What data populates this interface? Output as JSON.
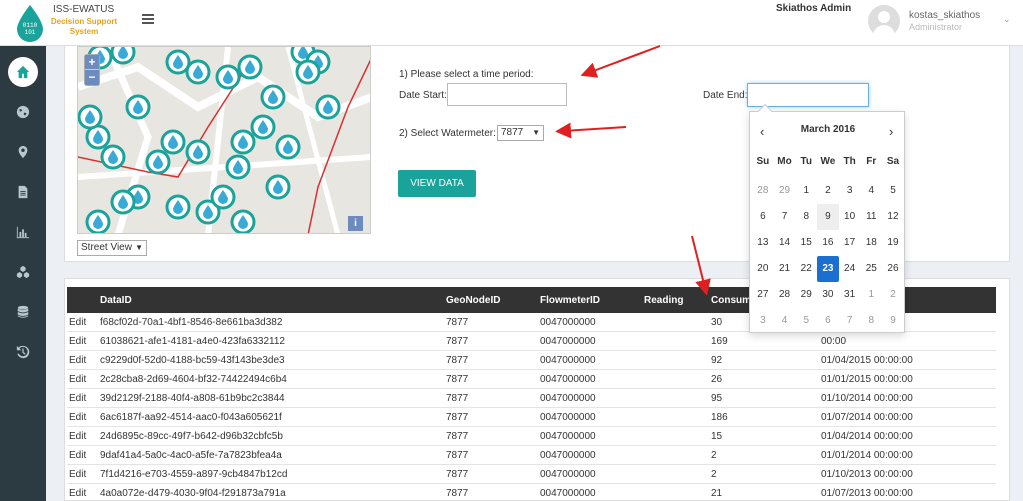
{
  "header": {
    "app_title": "ISS-EWATUS",
    "app_subtitle": "Decision Support System",
    "admin_label": "Skiathos Admin",
    "user_name": "kostas_skiathos",
    "user_role": "Administrator"
  },
  "sidebar": {
    "items": [
      {
        "name": "home",
        "icon": "home-icon"
      },
      {
        "name": "globe",
        "icon": "globe-icon"
      },
      {
        "name": "location",
        "icon": "map-marker-icon"
      },
      {
        "name": "documents",
        "icon": "document-icon"
      },
      {
        "name": "charts",
        "icon": "bar-chart-icon"
      },
      {
        "name": "cubes",
        "icon": "cubes-icon"
      },
      {
        "name": "database",
        "icon": "database-icon"
      },
      {
        "name": "history",
        "icon": "history-icon"
      }
    ]
  },
  "map": {
    "zoom_in": "+",
    "zoom_out": "−",
    "info": "i",
    "view_selected": "Street View"
  },
  "form": {
    "step1_label": "1) Please select a time period:",
    "date_start_label": "Date Start:",
    "date_start_value": "",
    "date_end_label": "Date End:",
    "date_end_value": "",
    "step2_label": "2) Select Watermeter:",
    "watermeter_selected": "7877",
    "view_button": "VIEW DATA"
  },
  "datepicker": {
    "month_label": "March 2016",
    "prev": "‹",
    "next": "›",
    "weekdays": [
      "Su",
      "Mo",
      "Tu",
      "We",
      "Th",
      "Fr",
      "Sa"
    ],
    "weeks": [
      [
        "28",
        "29",
        "1",
        "2",
        "3",
        "4",
        "5"
      ],
      [
        "6",
        "7",
        "8",
        "9",
        "10",
        "11",
        "12"
      ],
      [
        "13",
        "14",
        "15",
        "16",
        "17",
        "18",
        "19"
      ],
      [
        "20",
        "21",
        "22",
        "23",
        "24",
        "25",
        "26"
      ],
      [
        "27",
        "28",
        "29",
        "30",
        "31",
        "1",
        "2"
      ],
      [
        "3",
        "4",
        "5",
        "6",
        "7",
        "8",
        "9"
      ]
    ],
    "selected_day": "23",
    "hover_day": "9"
  },
  "table": {
    "headers": [
      "DataID",
      "GeoNodeID",
      "FlowmeterID",
      "Reading",
      "Consum",
      ""
    ],
    "rows": [
      {
        "action": "Edit",
        "id": "f68cf02d-70a1-4bf1-8546-8e661ba3d382",
        "geo": "7877",
        "flow": "0047000000",
        "reading": "",
        "cons": "30",
        "date": "00:00"
      },
      {
        "action": "Edit",
        "id": "61038621-afe1-4181-a4e0-423fa6332112",
        "geo": "7877",
        "flow": "0047000000",
        "reading": "",
        "cons": "169",
        "date": "00:00"
      },
      {
        "action": "Edit",
        "id": "c9229d0f-52d0-4188-bc59-43f143be3de3",
        "geo": "7877",
        "flow": "0047000000",
        "reading": "",
        "cons": "92",
        "date": "01/04/2015 00:00:00"
      },
      {
        "action": "Edit",
        "id": "2c28cba8-2d69-4604-bf32-74422494c6b4",
        "geo": "7877",
        "flow": "0047000000",
        "reading": "",
        "cons": "26",
        "date": "01/01/2015 00:00:00"
      },
      {
        "action": "Edit",
        "id": "39d2129f-2188-40f4-a808-61b9bc2c3844",
        "geo": "7877",
        "flow": "0047000000",
        "reading": "",
        "cons": "95",
        "date": "01/10/2014 00:00:00"
      },
      {
        "action": "Edit",
        "id": "6ac6187f-aa92-4514-aac0-f043a605621f",
        "geo": "7877",
        "flow": "0047000000",
        "reading": "",
        "cons": "186",
        "date": "01/07/2014 00:00:00"
      },
      {
        "action": "Edit",
        "id": "24d6895c-89cc-49f7-b642-d96b32cbfc5b",
        "geo": "7877",
        "flow": "0047000000",
        "reading": "",
        "cons": "15",
        "date": "01/04/2014 00:00:00"
      },
      {
        "action": "Edit",
        "id": "9daf41a4-5a0c-4ac0-a5fe-7a7823bfea4a",
        "geo": "7877",
        "flow": "0047000000",
        "reading": "",
        "cons": "2",
        "date": "01/01/2014 00:00:00"
      },
      {
        "action": "Edit",
        "id": "7f1d4216-e703-4559-a897-9cb4847b12cd",
        "geo": "7877",
        "flow": "0047000000",
        "reading": "",
        "cons": "2",
        "date": "01/10/2013 00:00:00"
      },
      {
        "action": "Edit",
        "id": "4a0a072e-d479-4030-9f04-f291873a791a",
        "geo": "7877",
        "flow": "0047000000",
        "reading": "",
        "cons": "21",
        "date": "01/07/2013 00:00:00"
      }
    ]
  },
  "colors": {
    "accent": "#1aa39a",
    "sidebar_bg": "#2c3b41",
    "table_header_bg": "#333333",
    "annotation_arrow": "#e02020",
    "datepicker_active": "#1a6fd1"
  }
}
